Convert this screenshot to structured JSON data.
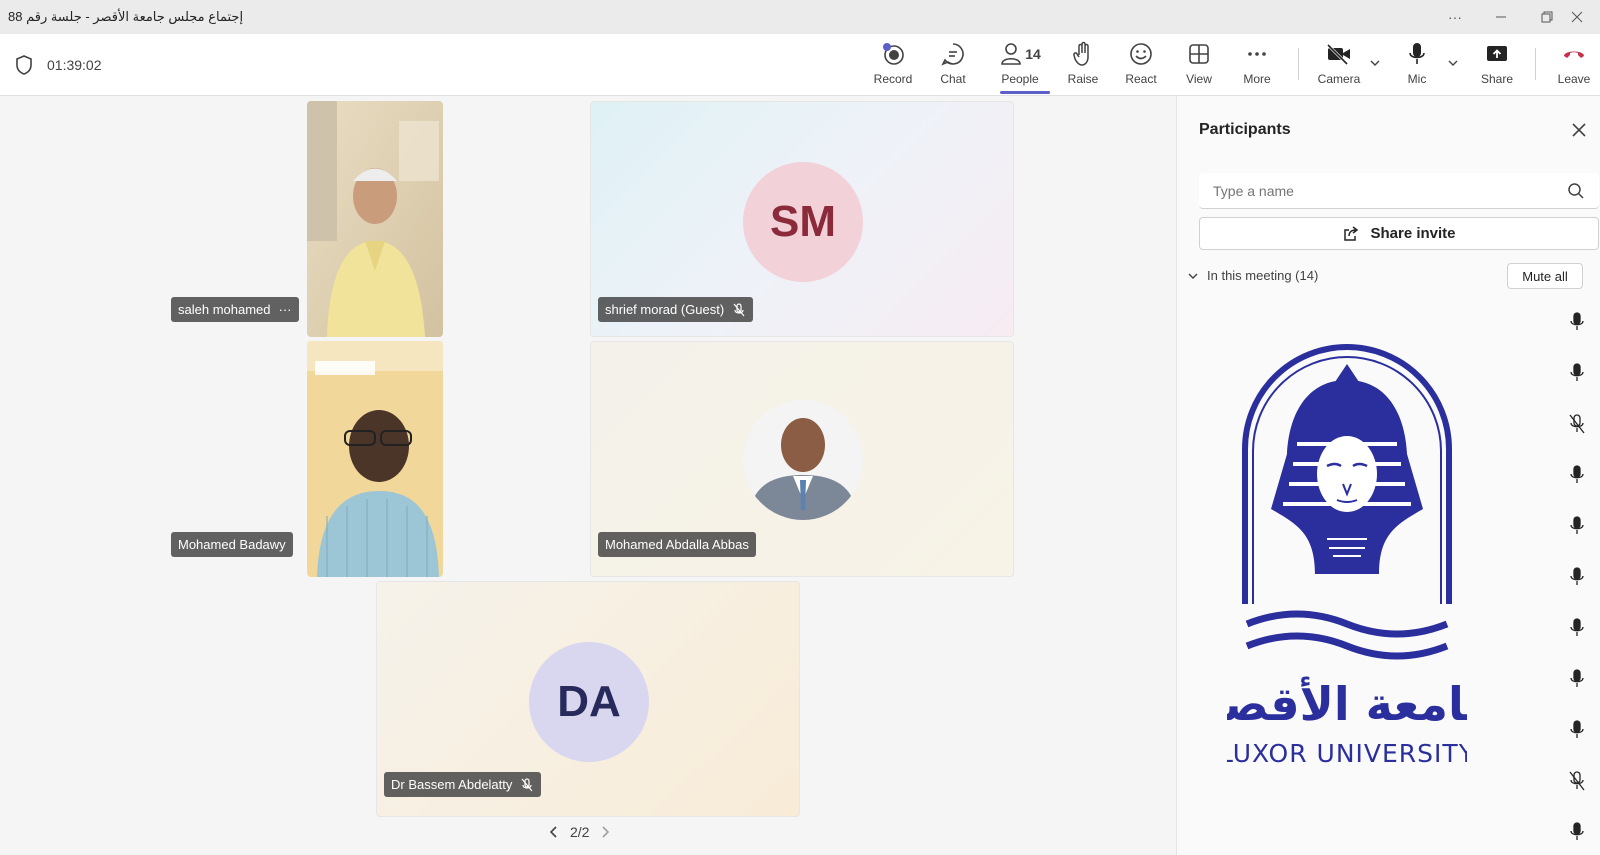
{
  "window": {
    "title": "إجتماع مجلس جامعة الأقصر - جلسة رقم 88"
  },
  "toolbar": {
    "timer": "01:39:02",
    "record_label": "Record",
    "chat_label": "Chat",
    "people_count": "14",
    "people_label": "People",
    "raise_label": "Raise",
    "react_label": "React",
    "view_label": "View",
    "more_label": "More",
    "camera_label": "Camera",
    "mic_label": "Mic",
    "share_label": "Share",
    "leave_label": "Leave",
    "leave_color": "#c4314b"
  },
  "stage": {
    "tiles": [
      {
        "name": "saleh mohamed",
        "more": "···"
      },
      {
        "name": "shrief morad (Guest)",
        "initials": "SM"
      },
      {
        "name": "Mohamed Badawy"
      },
      {
        "name": "Mohamed Abdalla Abbas"
      },
      {
        "name": "Dr Bassem Abdelatty",
        "initials": "DA"
      }
    ],
    "pager": "2/2"
  },
  "panel": {
    "title": "Participants",
    "search_placeholder": "Type a name",
    "share_invite": "Share invite",
    "section_label": "In this meeting (14)",
    "mute_all": "Mute all",
    "mic_states": [
      "on",
      "on",
      "off",
      "on",
      "on",
      "on",
      "on",
      "on",
      "on",
      "off",
      "on"
    ],
    "logo_arabic": "جامعة الأقصر",
    "logo_english": "LUXOR UNIVERSITY",
    "logo_color": "#2b2f9e"
  }
}
